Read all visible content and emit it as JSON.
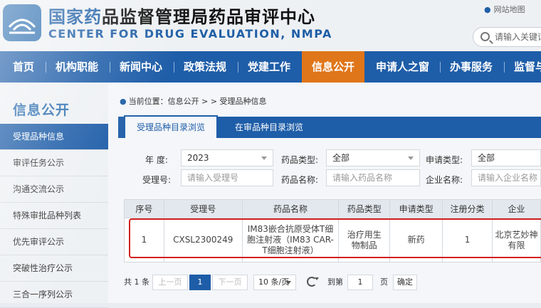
{
  "header": {
    "title_cn_a": "国家药",
    "title_cn_b": "品监督管理局药品审评中心",
    "title_en": "CENTER FOR DRUG EVALUATION, NMPA",
    "sitemap": "网站地图",
    "search_placeholder": "请输入关键词"
  },
  "nav": [
    {
      "label": "首页"
    },
    {
      "label": "机构职能"
    },
    {
      "label": "新闻中心"
    },
    {
      "label": "政策法规"
    },
    {
      "label": "党建工作"
    },
    {
      "label": "信息公开"
    },
    {
      "label": "申请人之窗"
    },
    {
      "label": "办事服务"
    },
    {
      "label": "监督与"
    }
  ],
  "sidebar": {
    "title": "信息公开",
    "items": [
      {
        "label": "受理品种信息"
      },
      {
        "label": "审评任务公示"
      },
      {
        "label": "沟通交流公示"
      },
      {
        "label": "特殊审批品种列表"
      },
      {
        "label": "优先审评公示"
      },
      {
        "label": "突破性治疗公示"
      },
      {
        "label": "三合一序列公示"
      }
    ]
  },
  "breadcrumb": "当前位置：信息公开 > > 受理品种信息",
  "tabs": [
    {
      "label": "受理品种目录浏览"
    },
    {
      "label": "在审品种目录浏览"
    }
  ],
  "filters": {
    "year_label": "年 度:",
    "year_value": "2023",
    "drug_type_label": "药品类型:",
    "drug_type_value": "全部",
    "apply_type_label": "申请类型:",
    "apply_type_value": "全部",
    "accept_no_label": "受理号:",
    "accept_no_placeholder": "请输入受理号",
    "drug_name_label": "药品名称:",
    "drug_name_placeholder": "请输入药品名称",
    "company_label": "企业名称:",
    "company_placeholder": "请输入企业名称"
  },
  "table": {
    "headers": [
      "序号",
      "受理号",
      "药品名称",
      "药品类型",
      "申请类型",
      "注册分类",
      "企业"
    ],
    "rows": [
      {
        "index": "1",
        "accept_no": "CXSL2300249",
        "drug_name_l1": "IM83嵌合抗原受体T细",
        "drug_name_l2": "胞注射液（IM83 CAR-",
        "drug_name_l3": "T细胞注射液）",
        "drug_type_l1": "治疗用生",
        "drug_type_l2": "物制品",
        "apply_type": "新药",
        "reg_class": "1",
        "company_l1": "北京艺妙神",
        "company_l2": "有限"
      }
    ]
  },
  "pagination": {
    "total": "共 1 条",
    "prev": "上一页",
    "current": "1",
    "next": "下一页",
    "page_size": "10 条/页",
    "goto": "到第",
    "goto_value": "1",
    "page": "页",
    "confirm": "确定"
  }
}
